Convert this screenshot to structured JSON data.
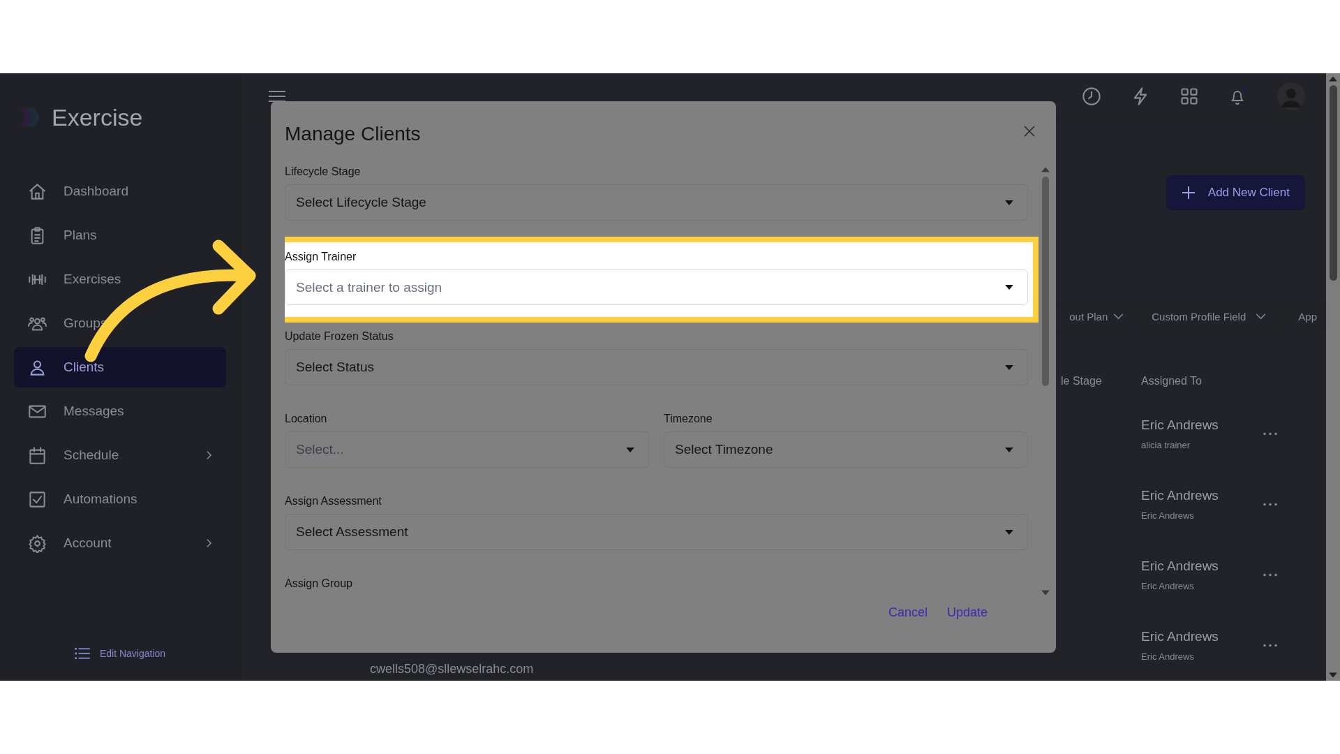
{
  "sidebar": {
    "logo": "Exercise",
    "items": [
      {
        "label": "Dashboard",
        "selected": false,
        "expandable": false
      },
      {
        "label": "Plans",
        "selected": false,
        "expandable": false
      },
      {
        "label": "Exercises",
        "selected": false,
        "expandable": false
      },
      {
        "label": "Groups",
        "selected": false,
        "expandable": false
      },
      {
        "label": "Clients",
        "selected": true,
        "expandable": false
      },
      {
        "label": "Messages",
        "selected": false,
        "expandable": false
      },
      {
        "label": "Schedule",
        "selected": false,
        "expandable": true
      },
      {
        "label": "Automations",
        "selected": false,
        "expandable": false
      },
      {
        "label": "Account",
        "selected": false,
        "expandable": true
      }
    ],
    "edit_navigation": "Edit Navigation"
  },
  "toolbar": {
    "add_button": "Add New Client"
  },
  "filters": [
    "out Plan",
    "Custom Profile Field",
    "App"
  ],
  "table": {
    "columns": [
      "le Stage",
      "Assigned To"
    ],
    "rows": [
      {
        "email": "",
        "assigned_to": "Eric Andrews",
        "assigned_by": "alicia trainer"
      },
      {
        "email": "",
        "assigned_to": "Eric Andrews",
        "assigned_by": "Eric Andrews"
      },
      {
        "email": "",
        "assigned_to": "Eric Andrews",
        "assigned_by": "Eric Andrews"
      },
      {
        "email": "cwells508@sllewselrahc.com",
        "assigned_to": "Eric Andrews",
        "assigned_by": "Eric Andrews"
      }
    ]
  },
  "modal": {
    "title": "Manage Clients",
    "fields": [
      {
        "kind": "select",
        "label": "Lifecycle Stage",
        "value": "Select Lifecycle Stage",
        "highlighted": false
      },
      {
        "kind": "select",
        "label": "Assign Trainer",
        "placeholder": "Select a trainer to assign",
        "highlighted": true
      },
      {
        "kind": "select",
        "label": "Update Frozen Status",
        "value": "Select Status",
        "highlighted": false
      },
      {
        "kind": "pair",
        "fields": [
          {
            "label": "Location",
            "placeholder": "Select..."
          },
          {
            "label": "Timezone",
            "value": "Select Timezone"
          }
        ],
        "highlighted": false
      },
      {
        "kind": "select",
        "label": "Assign Assessment",
        "value": "Select Assessment",
        "highlighted": false
      },
      {
        "kind": "heading",
        "label": "Assign Group",
        "highlighted": false
      }
    ],
    "cancel": "Cancel",
    "update": "Update"
  }
}
